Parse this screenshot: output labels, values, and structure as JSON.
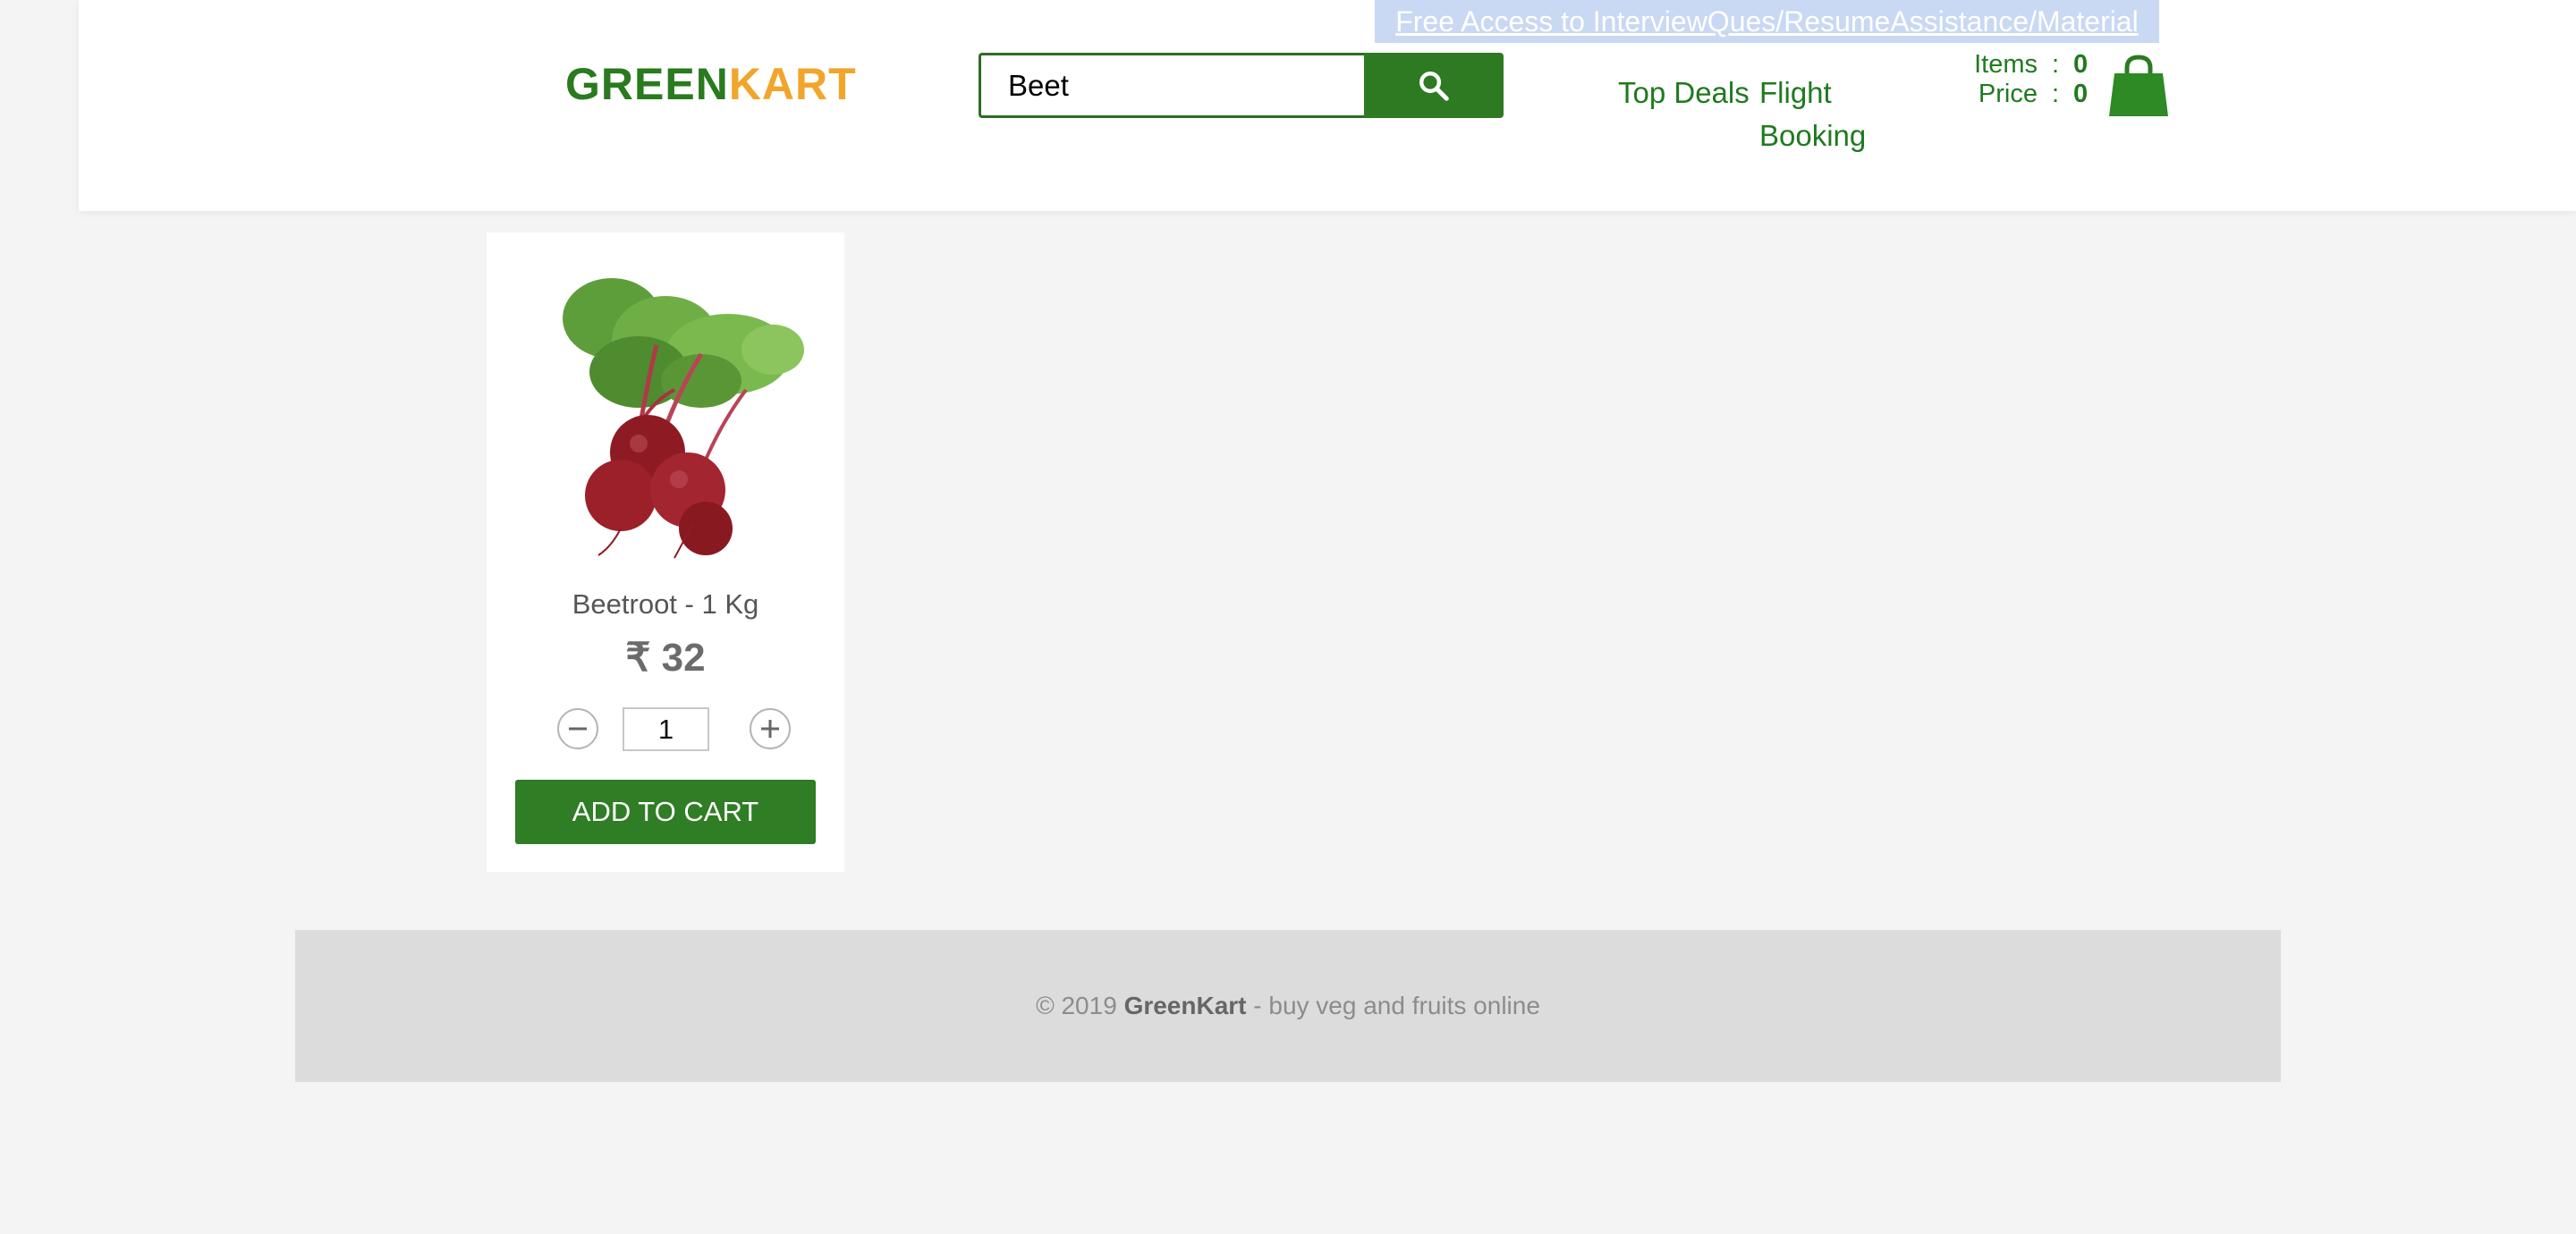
{
  "promo": {
    "link_text": "Free Access to InterviewQues/ResumeAssistance/Material"
  },
  "logo": {
    "part1": "GREEN",
    "part2": "KART",
    "color1": "#2a7a1f",
    "color2": "#f2a52b"
  },
  "search": {
    "value": "Beet",
    "button_icon": "search-icon"
  },
  "nav": {
    "top_deals": "Top Deals",
    "flight_booking": "Flight Booking"
  },
  "cart": {
    "items_label": "Items",
    "items_value": "0",
    "price_label": "Price",
    "price_value": "0",
    "separator": ":",
    "icon": "shopping-bag-icon"
  },
  "product": {
    "name": "Beetroot - 1 Kg",
    "price": "₹ 32",
    "quantity": "1",
    "decrement_icon": "minus-icon",
    "increment_icon": "plus-icon",
    "add_to_cart_label": "ADD TO CART"
  },
  "footer": {
    "copyright": "© 2019",
    "brand": "GreenKart",
    "tagline": "- buy veg and fruits online"
  },
  "colors": {
    "brand_green": "#2d7a22",
    "brand_orange": "#f2a52b",
    "background": "#f4f4f4",
    "footer_bg": "#dcdcdc"
  }
}
